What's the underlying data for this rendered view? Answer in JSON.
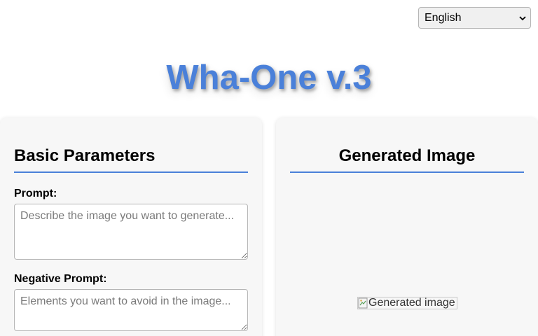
{
  "language": {
    "selected": "English",
    "icon": "chevron-down-icon"
  },
  "header": {
    "title": "Wha-One v.3"
  },
  "basic_parameters": {
    "heading": "Basic Parameters",
    "prompt": {
      "label": "Prompt:",
      "value": "",
      "placeholder": "Describe the image you want to generate..."
    },
    "negative_prompt": {
      "label": "Negative Prompt:",
      "value": "",
      "placeholder": "Elements you want to avoid in the image..."
    }
  },
  "generated_image": {
    "heading": "Generated Image",
    "alt_text": "Generated image",
    "icon": "broken-image-icon"
  },
  "colors": {
    "accent": "#4a80d9",
    "panel_background": "#f7f7f7"
  }
}
